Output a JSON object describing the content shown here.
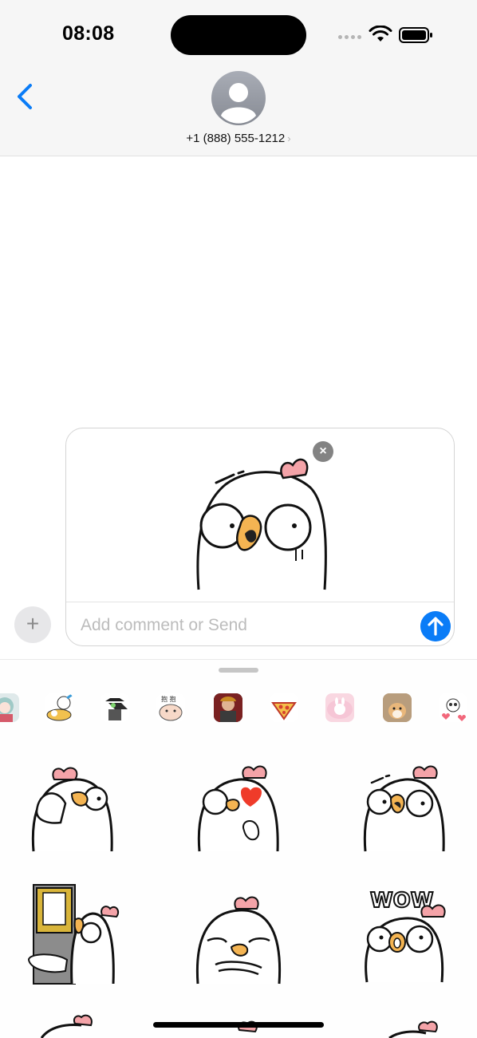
{
  "status_bar": {
    "time": "08:08"
  },
  "header": {
    "contact": "+1 (888) 555-1212",
    "contact_chevron": "›"
  },
  "compose": {
    "placeholder": "Add comment or Send",
    "remove_glyph": "×",
    "plus_glyph": "+"
  },
  "sticker_packs": [
    "girl-sticker-pack",
    "duck-breakfast-pack",
    "plague-doctor-pack",
    "bear-pack",
    "portrait-pack",
    "pizza-pack",
    "pink-bunny-pack",
    "shiba-pack",
    "skull-hearts-pack"
  ],
  "stickers": [
    "chicken-facepalm",
    "chicken-heart-blush",
    "chicken-shocked",
    "chicken-peek-door",
    "chicken-smug",
    "chicken-wow",
    "chicken-partial-1",
    "chicken-partial-2",
    "chicken-partial-3"
  ],
  "sticker_wow_text": "WOW",
  "colors": {
    "accent": "#0a7cf7",
    "chicken_comb": "#f4a3a8",
    "chicken_beak": "#f4b452"
  }
}
